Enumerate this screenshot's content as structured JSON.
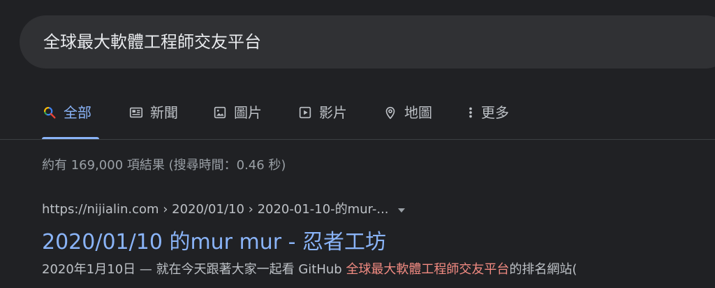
{
  "search": {
    "query": "全球最大軟體工程師交友平台"
  },
  "tabs": [
    {
      "label": "全部",
      "icon": "search-icon",
      "active": true
    },
    {
      "label": "新聞",
      "icon": "news-icon",
      "active": false
    },
    {
      "label": "圖片",
      "icon": "image-icon",
      "active": false
    },
    {
      "label": "影片",
      "icon": "video-icon",
      "active": false
    },
    {
      "label": "地圖",
      "icon": "map-pin-icon",
      "active": false
    },
    {
      "label": "更多",
      "icon": "more-vertical-icon",
      "active": false
    }
  ],
  "result_stats": "約有 169,000 項結果 (搜尋時間：0.46 秒)",
  "result": {
    "url": "https://nijialin.com › 2020/01/10 › 2020-01-10-的mur-...",
    "title": "2020/01/10 的mur mur - 忍者工坊",
    "snippet_before": "2020年1月10日 — 就在今天跟著大家一起看 GitHub ",
    "snippet_highlight": "全球最大軟體工程師交友平台",
    "snippet_after": "的排名網站("
  },
  "colors": {
    "background": "#202124",
    "search_box": "#303134",
    "link": "#8ab4f8",
    "highlight": "#f28b82",
    "text_secondary": "#bdc1c6",
    "text_muted": "#9aa0a6",
    "divider": "#3c4043"
  }
}
